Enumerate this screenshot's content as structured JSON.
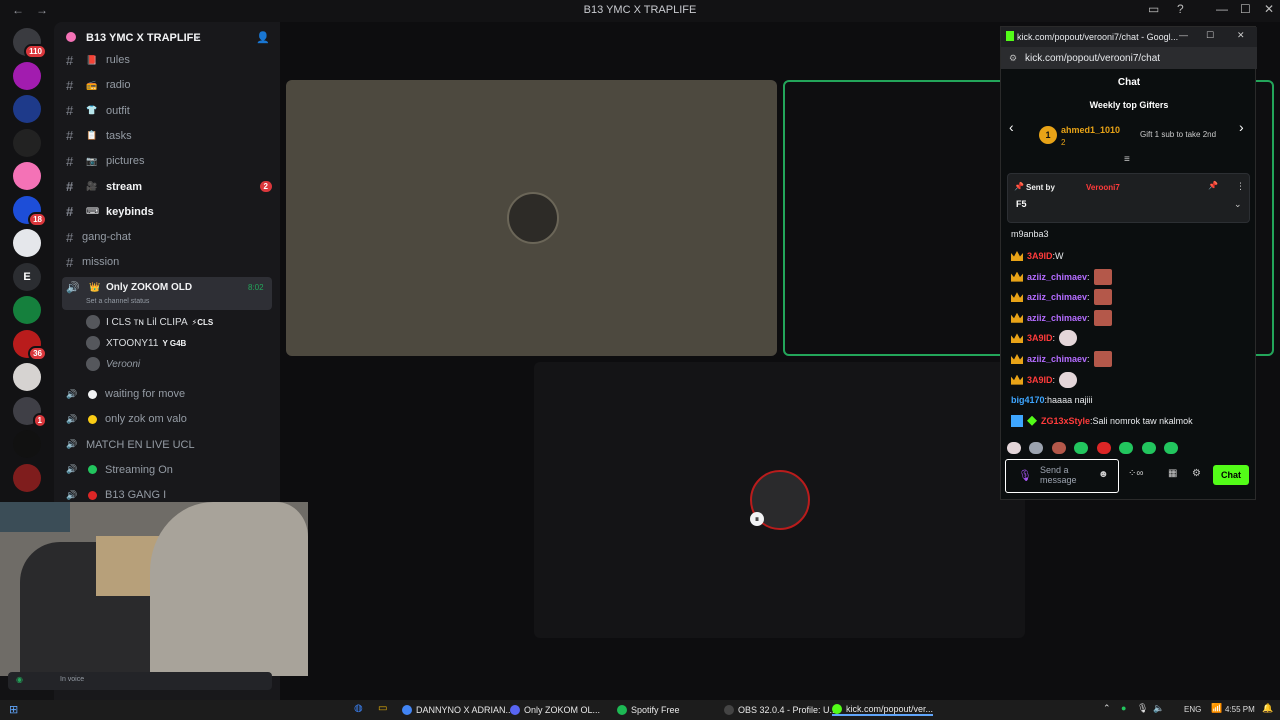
{
  "window": {
    "title": "B13 YMC X TRAPLIFE"
  },
  "servers": [
    {
      "badge": "110",
      "color": "#3a3b40"
    },
    {
      "badge": "",
      "color": "#a21caf"
    },
    {
      "badge": "",
      "color": "#1e3a8a"
    },
    {
      "badge": "",
      "color": "#222"
    },
    {
      "badge": "",
      "color": "#f472b6"
    },
    {
      "badge": "18",
      "color": "#1d4ed8"
    },
    {
      "badge": "",
      "color": "#e5e7eb"
    },
    {
      "badge": "",
      "color": "#2b2d31",
      "letter": "E"
    },
    {
      "badge": "",
      "color": "#15803d"
    },
    {
      "badge": "36",
      "color": "#b91c1c"
    },
    {
      "badge": "",
      "color": "#d6d3d1"
    },
    {
      "badge": "1",
      "color": "#3f3f46"
    },
    {
      "badge": "",
      "color": "#111"
    },
    {
      "badge": "",
      "color": "#7f1d1d"
    }
  ],
  "server_name": "B13 YMC X TRAPLIFE",
  "channels": [
    {
      "label": "rules",
      "emoji": "📕",
      "bold": false,
      "count": ""
    },
    {
      "label": "radio",
      "emoji": "📻",
      "bold": false,
      "count": ""
    },
    {
      "label": "outfit",
      "emoji": "👕",
      "bold": false,
      "count": ""
    },
    {
      "label": "tasks",
      "emoji": "📋",
      "bold": false,
      "count": ""
    },
    {
      "label": "pictures",
      "emoji": "📷",
      "bold": false,
      "count": ""
    },
    {
      "label": "stream",
      "emoji": "🎥",
      "bold": true,
      "count": "2"
    },
    {
      "label": "keybinds",
      "emoji": "⌨",
      "bold": true,
      "count": ""
    },
    {
      "label": "gang-chat",
      "emoji": "",
      "bold": false,
      "count": ""
    },
    {
      "label": "mission",
      "emoji": "",
      "bold": false,
      "count": ""
    }
  ],
  "voice_active": {
    "label": "Only ZOKOM OLD",
    "time": "8:02",
    "status": "Set a channel status"
  },
  "voice_users": [
    {
      "name": "I CLS ᴛɴ Lil CLIPA",
      "tag": "⚡CLS"
    },
    {
      "name": "XTOONY11",
      "tag": "Y G4B"
    },
    {
      "name": "Verooni",
      "tag": ""
    }
  ],
  "voice_channels": [
    {
      "label": "waiting for move",
      "dot": "#f2f3f5"
    },
    {
      "label": "only zok om valo",
      "dot": "#facc15"
    },
    {
      "label": "MATCH EN LIVE UCL",
      "dot": ""
    },
    {
      "label": "Streaming On",
      "dot": "#22c55e"
    },
    {
      "label": "B13 GANG I",
      "dot": "#dc2626"
    }
  ],
  "webcam_status": "In voice",
  "chat": {
    "window_title": "kick.com/popout/verooni7/chat - Googl...",
    "url": "kick.com/popout/verooni7/chat",
    "header": "Chat",
    "gifters_title": "Weekly top Gifters",
    "top_gifter": {
      "rank": "1",
      "name": "ahmed1_1010",
      "count": "2"
    },
    "gift_hint": "Gift 1 sub to take 2nd",
    "pinned_by_label": "Sent by",
    "pinned_user": "Verooni7",
    "pinned_text": "F5",
    "partial_message": "m9anba3",
    "messages": [
      {
        "user": "3A9ID",
        "text": "W",
        "crown": true,
        "emote": "",
        "cls": "n-red"
      },
      {
        "user": "aziiz_chimaev",
        "text": "",
        "crown": true,
        "emote": "face",
        "cls": "n-purple"
      },
      {
        "user": "aziiz_chimaev",
        "text": "",
        "crown": true,
        "emote": "face",
        "cls": "n-purple"
      },
      {
        "user": "aziiz_chimaev",
        "text": "",
        "crown": true,
        "emote": "face",
        "cls": "n-purple"
      },
      {
        "user": "3A9ID",
        "text": "",
        "crown": true,
        "emote": "cat",
        "cls": "n-red"
      },
      {
        "user": "aziiz_chimaev",
        "text": "",
        "crown": true,
        "emote": "face",
        "cls": "n-purple"
      },
      {
        "user": "3A9ID",
        "text": "",
        "crown": true,
        "emote": "cat",
        "cls": "n-red"
      },
      {
        "user": "big4170",
        "text": "haaaa najiii",
        "crown": false,
        "emote": "",
        "cls": "n-blue"
      },
      {
        "user": "ZG13xStyle",
        "text": "Sali nomrok taw nkalmok",
        "crown": false,
        "emote": "",
        "cls": "n-red"
      }
    ],
    "input_placeholder": "Send a message",
    "send_label": "Chat"
  },
  "taskbar": [
    {
      "label": "DANNYNO X ADRIAN...",
      "color": "#4285f4"
    },
    {
      "label": "Only ZOKOM OL...",
      "color": "#5865f2"
    },
    {
      "label": "Spotify Free",
      "color": "#1db954"
    },
    {
      "label": "OBS 32.0.4 - Profile: U...",
      "color": "#444"
    },
    {
      "label": "kick.com/popout/ver...",
      "color": "#53fc18"
    }
  ],
  "tray": {
    "lang": "ENG",
    "time": "4:55 PM"
  }
}
